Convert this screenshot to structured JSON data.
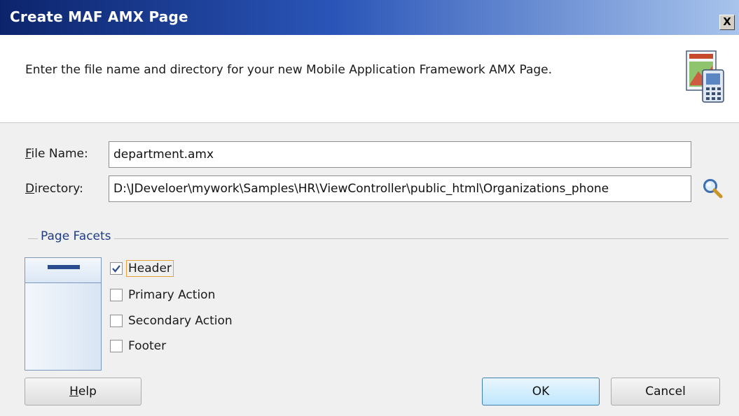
{
  "dialog": {
    "title": "Create MAF AMX Page",
    "close_glyph": "X",
    "instruction": "Enter the file name and directory for your new Mobile Application Framework AMX Page."
  },
  "form": {
    "file_name": {
      "label_mnemonic": "F",
      "label_rest": "ile Name:",
      "value": "department.amx"
    },
    "directory": {
      "label_mnemonic": "D",
      "label_rest": "irectory:",
      "value": "D:\\JDeveloer\\mywork\\Samples\\HR\\ViewController\\public_html\\Organizations_phone",
      "browse_icon": "magnifier-icon"
    }
  },
  "facets": {
    "group_label": "Page Facets",
    "items": [
      {
        "label": "Header",
        "checked": true
      },
      {
        "label": "Primary Action",
        "checked": false
      },
      {
        "label": "Secondary Action",
        "checked": false
      },
      {
        "label": "Footer",
        "checked": false
      }
    ]
  },
  "buttons": {
    "help_mnemonic": "H",
    "help_rest": "elp",
    "ok": "OK",
    "cancel": "Cancel"
  },
  "colors": {
    "accent": "#2a55b8",
    "focus": "#e6a23c",
    "check": "#2a4d8f"
  }
}
